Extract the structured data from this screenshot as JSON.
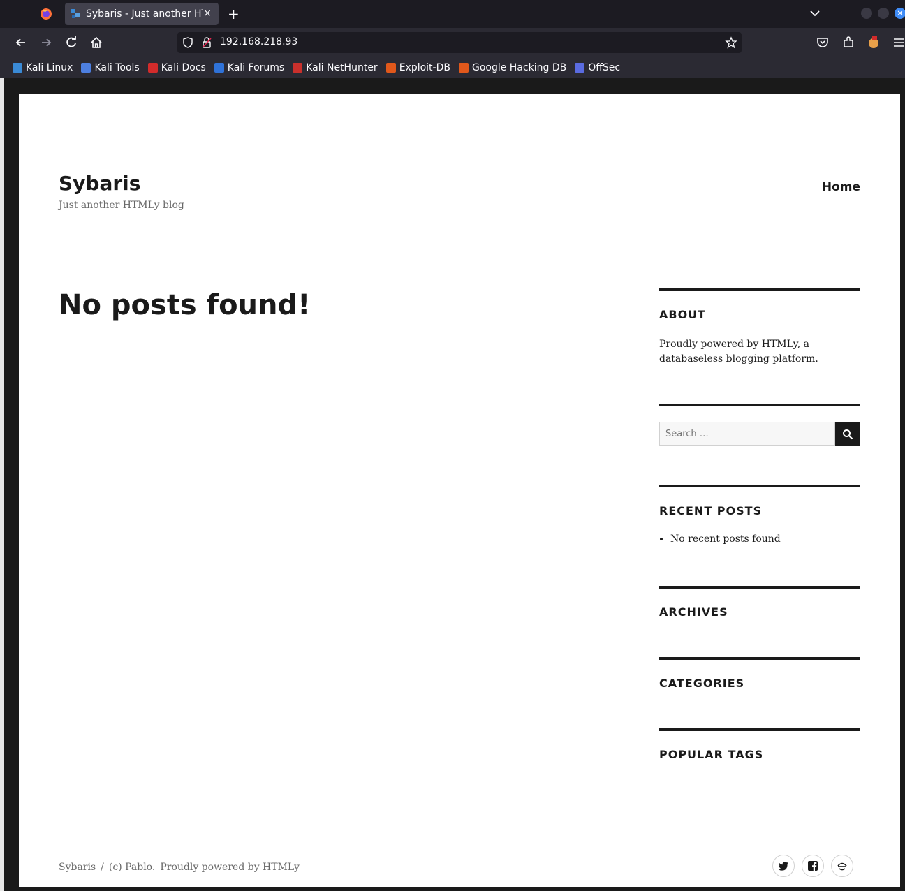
{
  "browser": {
    "tab_title": "Sybaris - Just another HTML",
    "tab_close": "×",
    "new_tab": "+",
    "url": "192.168.218.93",
    "window_close": "×"
  },
  "bookmarks": [
    {
      "label": "Kali Linux",
      "icon_color": "#3a8ad6"
    },
    {
      "label": "Kali Tools",
      "icon_color": "#4d7fe0"
    },
    {
      "label": "Kali Docs",
      "icon_color": "#d22b2b"
    },
    {
      "label": "Kali Forums",
      "icon_color": "#2f72d8"
    },
    {
      "label": "Kali NetHunter",
      "icon_color": "#c9302c"
    },
    {
      "label": "Exploit-DB",
      "icon_color": "#e0581b"
    },
    {
      "label": "Google Hacking DB",
      "icon_color": "#e0581b"
    },
    {
      "label": "OffSec",
      "icon_color": "#5a6be0"
    }
  ],
  "site": {
    "title": "Sybaris",
    "description": "Just another HTMLy blog",
    "nav_home": "Home"
  },
  "main": {
    "heading": "No posts found!"
  },
  "sidebar": {
    "about_title": "ABOUT",
    "about_text": "Proudly powered by HTMLy, a databaseless blogging platform.",
    "search_placeholder": "Search …",
    "recent_title": "RECENT POSTS",
    "recent_items": [
      "No recent posts found"
    ],
    "archives_title": "ARCHIVES",
    "categories_title": "CATEGORIES",
    "tags_title": "POPULAR TAGS"
  },
  "footer": {
    "site": "Sybaris",
    "separator": "/",
    "copyright": "(c) Pablo.",
    "powered": "Proudly powered by HTMLy",
    "social": [
      "twitter-icon",
      "facebook-icon",
      "feed-icon"
    ]
  }
}
